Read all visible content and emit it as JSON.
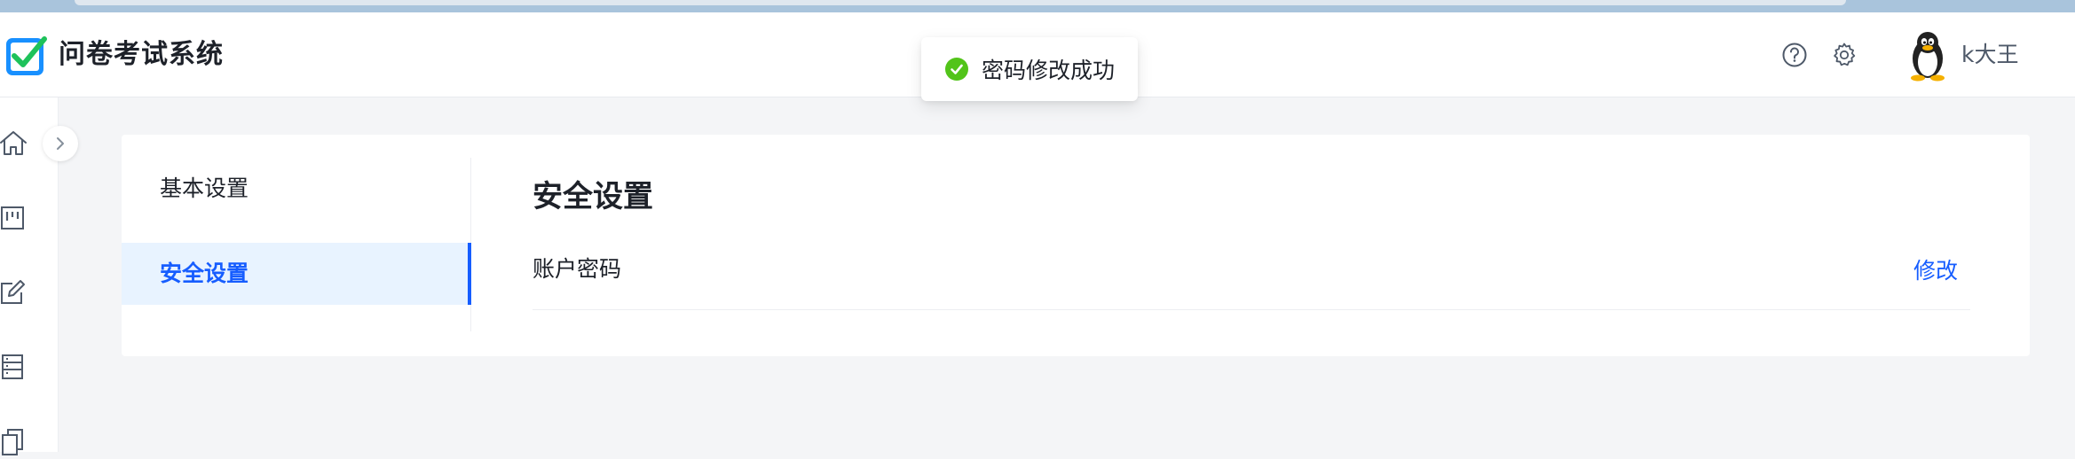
{
  "app": {
    "title": "问卷考试系统"
  },
  "header": {
    "username": "k大王",
    "icons": [
      "help-icon",
      "gear-icon"
    ]
  },
  "toast": {
    "message": "密码修改成功",
    "icon": "check-circle-icon",
    "color": "#52c41a"
  },
  "sidebar": {
    "icons": [
      "home-icon",
      "board-icon",
      "edit-icon",
      "list-icon",
      "copy-icon"
    ],
    "collapse_icon": "chevron-right-icon"
  },
  "settings_menu": {
    "items": [
      {
        "label": "基本设置",
        "active": false
      },
      {
        "label": "安全设置",
        "active": true
      }
    ]
  },
  "content": {
    "title": "安全设置",
    "rows": [
      {
        "label": "账户密码",
        "action": "修改"
      }
    ]
  },
  "colors": {
    "accent": "#165dff",
    "active_bg": "#e8f3ff",
    "success": "#52c41a"
  }
}
